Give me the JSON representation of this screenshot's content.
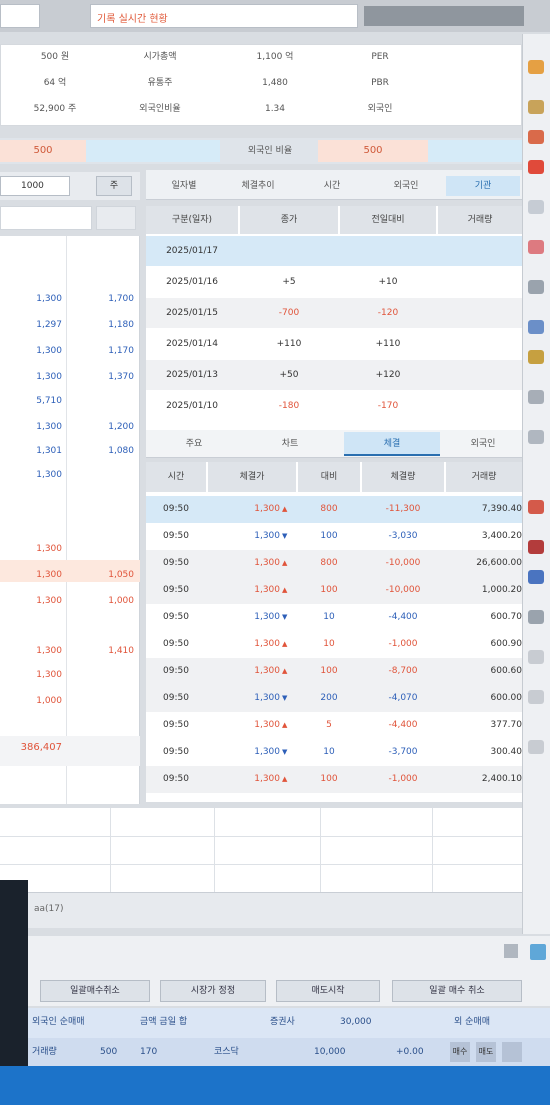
{
  "header": {
    "left_box": "",
    "title": "기록 실시간 현황"
  },
  "info_grid": {
    "rows": [
      [
        "500 원",
        "시가총액",
        "1,100 억",
        "PER",
        ""
      ],
      [
        "64 억",
        "유통주",
        "1,480",
        "PBR",
        ""
      ],
      [
        "52,900 주",
        "외국인비율",
        "1.34",
        "외국인",
        ""
      ]
    ]
  },
  "price_bar": {
    "left_value": "500",
    "mid_label": "외국인 비율",
    "mid_value": "500"
  },
  "left_tools": {
    "select": "1000",
    "button": "주"
  },
  "left_values": {
    "top": [
      {
        "a": "1,300",
        "b": "1,700"
      },
      {
        "a": "1,297",
        "b": "1,180"
      },
      {
        "a": "1,300",
        "b": "1,170"
      },
      {
        "a": "1,300",
        "b": "1,370"
      },
      {
        "a": "5,710",
        "b": ""
      },
      {
        "a": "1,300",
        "b": "1,200"
      },
      {
        "a": "1,301",
        "b": "1,080"
      },
      {
        "a": "1,300",
        "b": ""
      }
    ],
    "bottom": [
      {
        "a": "1,300",
        "b": ""
      },
      {
        "a": "1,300",
        "b": "1,050"
      },
      {
        "a": "1,300",
        "b": "1,000"
      },
      {
        "a": "",
        "b": ""
      },
      {
        "a": "1,300",
        "b": "1,410"
      },
      {
        "a": "1,300",
        "b": ""
      },
      {
        "a": "1,000",
        "b": ""
      }
    ],
    "total": "386,407"
  },
  "tabs": [
    "일자별",
    "체결추이",
    "시간",
    "외국인",
    "기관"
  ],
  "daily": {
    "headers": [
      "구분(일자)",
      "종가",
      "전일대비",
      "거래량"
    ],
    "rows": [
      {
        "date": "2025/01/17",
        "c1": "",
        "c2": "",
        "c3": "",
        "selected": true
      },
      {
        "date": "2025/01/16",
        "c1": "+5",
        "c2": "+10",
        "c3": ""
      },
      {
        "date": "2025/01/15",
        "c1": "-700",
        "c2": "-120",
        "c3": ""
      },
      {
        "date": "2025/01/14",
        "c1": "+110",
        "c2": "+110",
        "c3": ""
      },
      {
        "date": "2025/01/13",
        "c1": "+50",
        "c2": "+120",
        "c3": ""
      },
      {
        "date": "2025/01/10",
        "c1": "-180",
        "c2": "-170",
        "c3": ""
      }
    ]
  },
  "mid_tabs": [
    "주요",
    "차트",
    "체결",
    "외국인"
  ],
  "trades": {
    "headers": [
      "시간",
      "체결가",
      "대비",
      "체결량",
      "거래량"
    ],
    "rows": [
      {
        "t": "09:50",
        "p": "1,300",
        "d": "800",
        "v": "-11,300",
        "a": "7,390.40",
        "dir": "up",
        "sel": true
      },
      {
        "t": "09:50",
        "p": "1,300",
        "d": "100",
        "v": "-3,030",
        "a": "3,400.20",
        "dir": "dn"
      },
      {
        "t": "09:50",
        "p": "1,300",
        "d": "800",
        "v": "-10,000",
        "a": "26,600.00",
        "dir": "up"
      },
      {
        "t": "09:50",
        "p": "1,300",
        "d": "100",
        "v": "-10,000",
        "a": "1,000.20",
        "dir": "up"
      },
      {
        "t": "09:50",
        "p": "1,300",
        "d": "10",
        "v": "-4,400",
        "a": "600.70",
        "dir": "dn"
      },
      {
        "t": "09:50",
        "p": "1,300",
        "d": "10",
        "v": "-1,000",
        "a": "600.90",
        "dir": "up"
      },
      {
        "t": "09:50",
        "p": "1,300",
        "d": "100",
        "v": "-8,700",
        "a": "600.60",
        "dir": "up"
      },
      {
        "t": "09:50",
        "p": "1,300",
        "d": "200",
        "v": "-4,070",
        "a": "600.00",
        "dir": "dn"
      },
      {
        "t": "09:50",
        "p": "1,300",
        "d": "5",
        "v": "-4,400",
        "a": "377.70",
        "dir": "up"
      },
      {
        "t": "09:50",
        "p": "1,300",
        "d": "10",
        "v": "-3,700",
        "a": "300.40",
        "dir": "dn"
      },
      {
        "t": "09:50",
        "p": "1,300",
        "d": "100",
        "v": "-1,000",
        "a": "2,400.10",
        "dir": "up"
      }
    ]
  },
  "status": {
    "label": "aa(17)",
    "right": ""
  },
  "buttons": [
    "일괄매수취소",
    "시장가 정정",
    "매도시작",
    "일괄 매수 취소"
  ],
  "bands": {
    "line1": [
      "외국인 순매매",
      "금액 금일 합",
      "증권사",
      "30,000",
      "외 순매매"
    ],
    "line2": [
      "거래량",
      "500",
      "170",
      "코스닥",
      "10,000",
      "+0.00",
      "매수",
      "매도"
    ]
  },
  "colors": {
    "up": "#e0543a",
    "down": "#2d5fb8",
    "accent": "#2a6fb0",
    "taskbar": "#1c73c9"
  }
}
